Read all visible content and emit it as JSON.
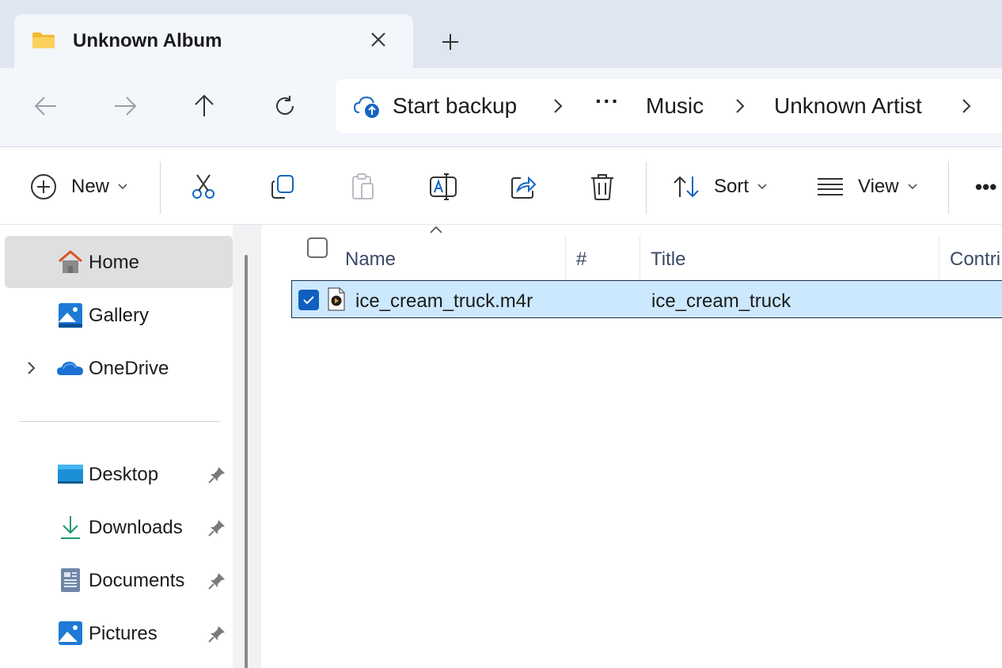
{
  "tab": {
    "title": "Unknown Album",
    "icon": "folder-icon"
  },
  "nav": {
    "back": "arrow-left-icon",
    "forward": "arrow-right-icon",
    "up": "arrow-up-icon",
    "refresh": "refresh-icon"
  },
  "address": {
    "backup_label": "Start backup",
    "more": "···",
    "crumbs": [
      "Music",
      "Unknown Artist"
    ]
  },
  "commands": {
    "new": "New",
    "sort": "Sort",
    "view": "View",
    "more": "•••"
  },
  "sidebar": {
    "items": [
      {
        "label": "Home",
        "icon": "home-icon",
        "selected": true
      },
      {
        "label": "Gallery",
        "icon": "gallery-icon"
      },
      {
        "label": "OneDrive",
        "icon": "onedrive-icon"
      },
      {
        "label": "Desktop",
        "icon": "desktop-icon",
        "pinned": true
      },
      {
        "label": "Downloads",
        "icon": "downloads-icon",
        "pinned": true
      },
      {
        "label": "Documents",
        "icon": "documents-icon",
        "pinned": true
      },
      {
        "label": "Pictures",
        "icon": "pictures-icon",
        "pinned": true
      }
    ]
  },
  "columns": {
    "name": "Name",
    "number": "#",
    "title": "Title",
    "contributing": "Contri"
  },
  "files": [
    {
      "name": "ice_cream_truck.m4r",
      "title": "ice_cream_truck",
      "selected": true
    }
  ],
  "colors": {
    "accent": "#0f5fbf",
    "selection": "#cce8ff",
    "chrome": "#dfe6ef"
  }
}
